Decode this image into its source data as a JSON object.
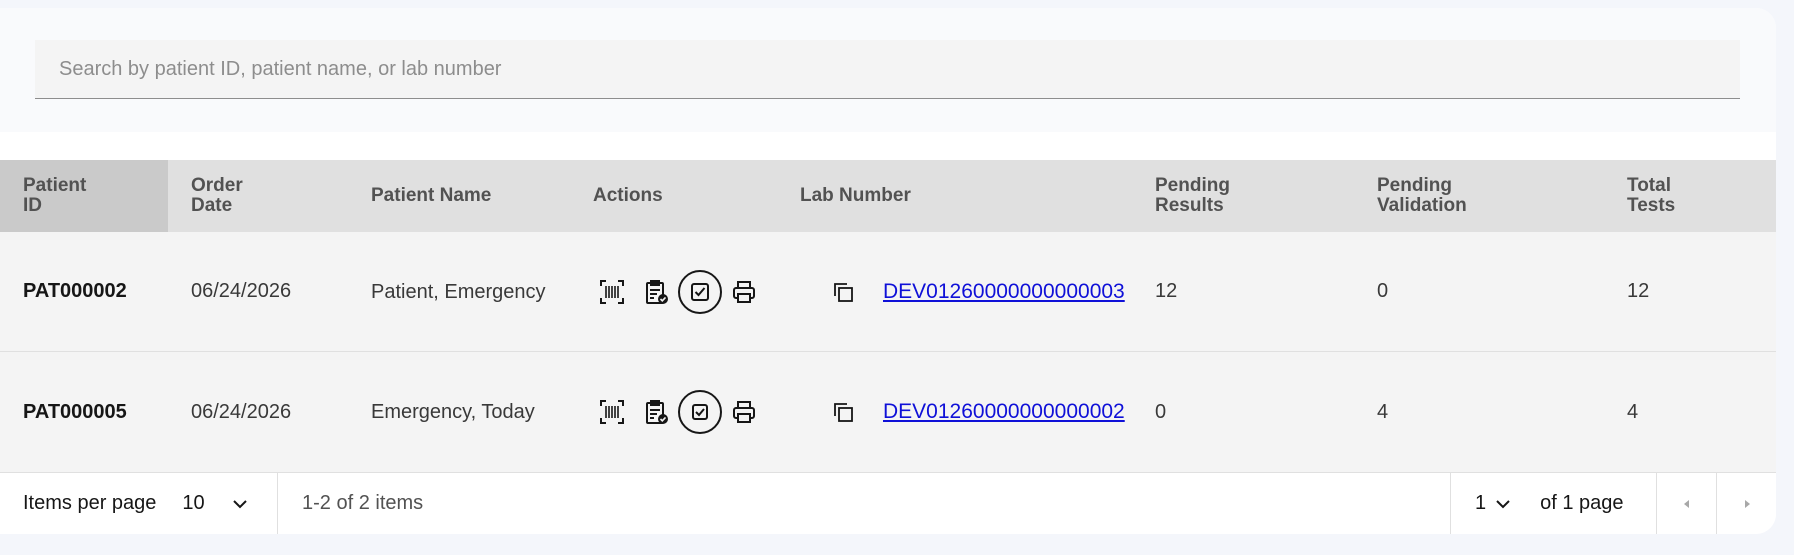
{
  "search": {
    "placeholder": "Search by patient ID, patient name, or lab number"
  },
  "table": {
    "headers": {
      "patient_id": "Patient ID",
      "order_date": "Order Date",
      "patient_name": "Patient Name",
      "actions": "Actions",
      "lab_number": "Lab Number",
      "pending_results": "Pending Results",
      "pending_validation": "Pending Validation",
      "total_tests": "Total Tests"
    },
    "rows": [
      {
        "patient_id": "PAT000002",
        "order_date": "06/24/2026",
        "patient_name": "Patient, Emergency",
        "lab_number": "DEV01260000000000003",
        "pending_results": "12",
        "pending_validation": "0",
        "total_tests": "12"
      },
      {
        "patient_id": "PAT000005",
        "order_date": "06/24/2026",
        "patient_name": "Emergency, Today",
        "lab_number": "DEV01260000000000002",
        "pending_results": "0",
        "pending_validation": "4",
        "total_tests": "4"
      }
    ]
  },
  "pagination": {
    "items_per_page_label": "Items per page",
    "items_per_page_value": "10",
    "range_text": "1-2 of 2 items",
    "page_value": "1",
    "page_total_text": "of 1 page"
  }
}
